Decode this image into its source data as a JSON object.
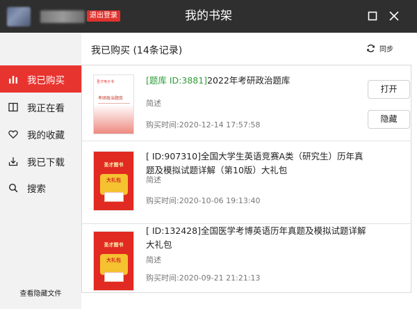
{
  "window": {
    "title": "我的书架",
    "logout_label": "退出登录"
  },
  "sidebar": {
    "items": [
      {
        "label": "我已购买",
        "icon": "bar-chart-icon",
        "active": true
      },
      {
        "label": "我正在看",
        "icon": "book-open-icon",
        "active": false
      },
      {
        "label": "我的收藏",
        "icon": "heart-icon",
        "active": false
      },
      {
        "label": "我已下载",
        "icon": "download-icon",
        "active": false
      },
      {
        "label": "搜索",
        "icon": "search-icon",
        "active": false
      }
    ],
    "hidden_files_label": "查看隐藏文件"
  },
  "header": {
    "title": "我已购买 (14条记录)",
    "sync_label": "同步"
  },
  "books": [
    {
      "tag": "[题库 ID:3881]",
      "title": "2022年考研政治题库",
      "summary": "简述",
      "purchase_time": "购买时间:2020-12-14 17:57:58",
      "open_label": "打开",
      "hide_label": "隐藏",
      "cover_brand": "圣才电子书",
      "cover_text": "考研政治题库"
    },
    {
      "tag": "",
      "title": "[ ID:907310]全国大学生英语竞赛A类（研究生）历年真题及模拟试题详解（第10版）大礼包",
      "summary": "简述",
      "purchase_time": "购买时间:2020-10-06 19:13:40",
      "cover_top": "圣才图书",
      "cover_bag": "大礼包"
    },
    {
      "tag": "",
      "title": "[ ID:132428]全国医学考博英语历年真题及模拟试题详解大礼包",
      "summary": "简述",
      "purchase_time": "购买时间:2020-09-21 21:21:13",
      "cover_top": "圣才图书",
      "cover_bag": "大礼包"
    }
  ],
  "colors": {
    "titlebar": "#2f2f2f",
    "accent_red": "#e8342f",
    "tag_green": "#2e9d37",
    "sidebar_bg": "#f2f2f2"
  }
}
